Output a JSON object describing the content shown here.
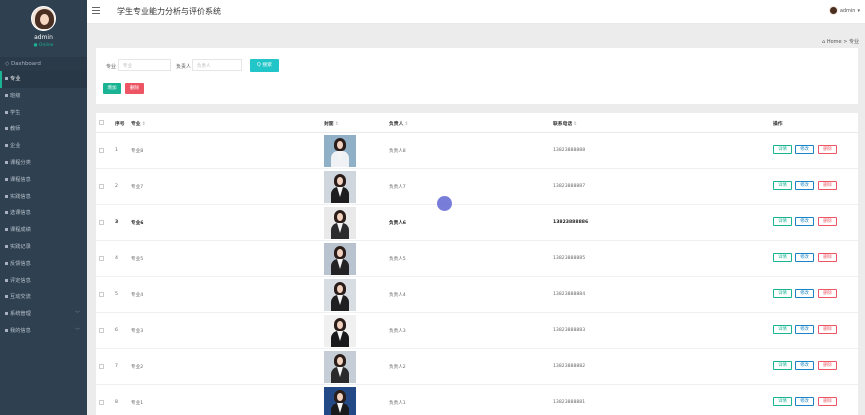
{
  "app": {
    "title": "学生专业能力分析与评价系统"
  },
  "user": {
    "name": "admin",
    "status": "● Online",
    "menu_label": "admin"
  },
  "sidebar": {
    "dashboard": "Dashboard",
    "items": [
      {
        "label": "专业",
        "active": true
      },
      {
        "label": "班级"
      },
      {
        "label": "学生"
      },
      {
        "label": "教师"
      },
      {
        "label": "企业"
      },
      {
        "label": "课程分类"
      },
      {
        "label": "课程信息"
      },
      {
        "label": "实践信息"
      },
      {
        "label": "选课信息"
      },
      {
        "label": "课程成绩"
      },
      {
        "label": "实践记录"
      },
      {
        "label": "反馈信息"
      },
      {
        "label": "评定信息"
      },
      {
        "label": "互动交流"
      },
      {
        "label": "系统管理",
        "expandable": true
      },
      {
        "label": "我的信息",
        "expandable": true
      }
    ]
  },
  "breadcrumb": {
    "home": "Home",
    "separator": ">",
    "current": "专业"
  },
  "search": {
    "major_label": "专业",
    "major_placeholder": "专业",
    "leader_label": "负责人",
    "leader_placeholder": "负责人",
    "search_button": "Q 搜索"
  },
  "actions": {
    "add": "增加",
    "delete": "删除"
  },
  "table": {
    "headers": {
      "index": "序号",
      "major": "专业",
      "cover": "封面",
      "leader": "负责人",
      "phone": "联系电话",
      "ops": "操作"
    },
    "sort_glyph": "⇕",
    "row_actions": {
      "detail": "详情",
      "edit": "修改",
      "remove": "删除"
    },
    "rows": [
      {
        "index": "1",
        "major": "专业8",
        "leader": "负责人8",
        "phone": "13823888888",
        "bg": "#8fb0c7",
        "outfit": "#eef2f5"
      },
      {
        "index": "2",
        "major": "专业7",
        "leader": "负责人7",
        "phone": "13823888887",
        "bg": "#cfd6de",
        "outfit": "#1d1d1f"
      },
      {
        "index": "3",
        "major": "专业6",
        "leader": "负责人6",
        "phone": "13823888886",
        "bg": "#e9e9ea",
        "outfit": "#2b2b2d",
        "bold": true
      },
      {
        "index": "4",
        "major": "专业5",
        "leader": "负责人5",
        "phone": "13823888885",
        "bg": "#b9c3cf",
        "outfit": "#232325"
      },
      {
        "index": "5",
        "major": "专业4",
        "leader": "负责人4",
        "phone": "13823888884",
        "bg": "#d8dde3",
        "outfit": "#1f1f21"
      },
      {
        "index": "6",
        "major": "专业3",
        "leader": "负责人3",
        "phone": "13823888883",
        "bg": "#f0f0f0",
        "outfit": "#19191b"
      },
      {
        "index": "7",
        "major": "专业2",
        "leader": "负责人2",
        "phone": "13823888882",
        "bg": "#c5cdd6",
        "outfit": "#2a2a2c"
      },
      {
        "index": "8",
        "major": "专业1",
        "leader": "负责人1",
        "phone": "13823888881",
        "bg": "#234a86",
        "outfit": "#1a1a1c"
      }
    ]
  }
}
